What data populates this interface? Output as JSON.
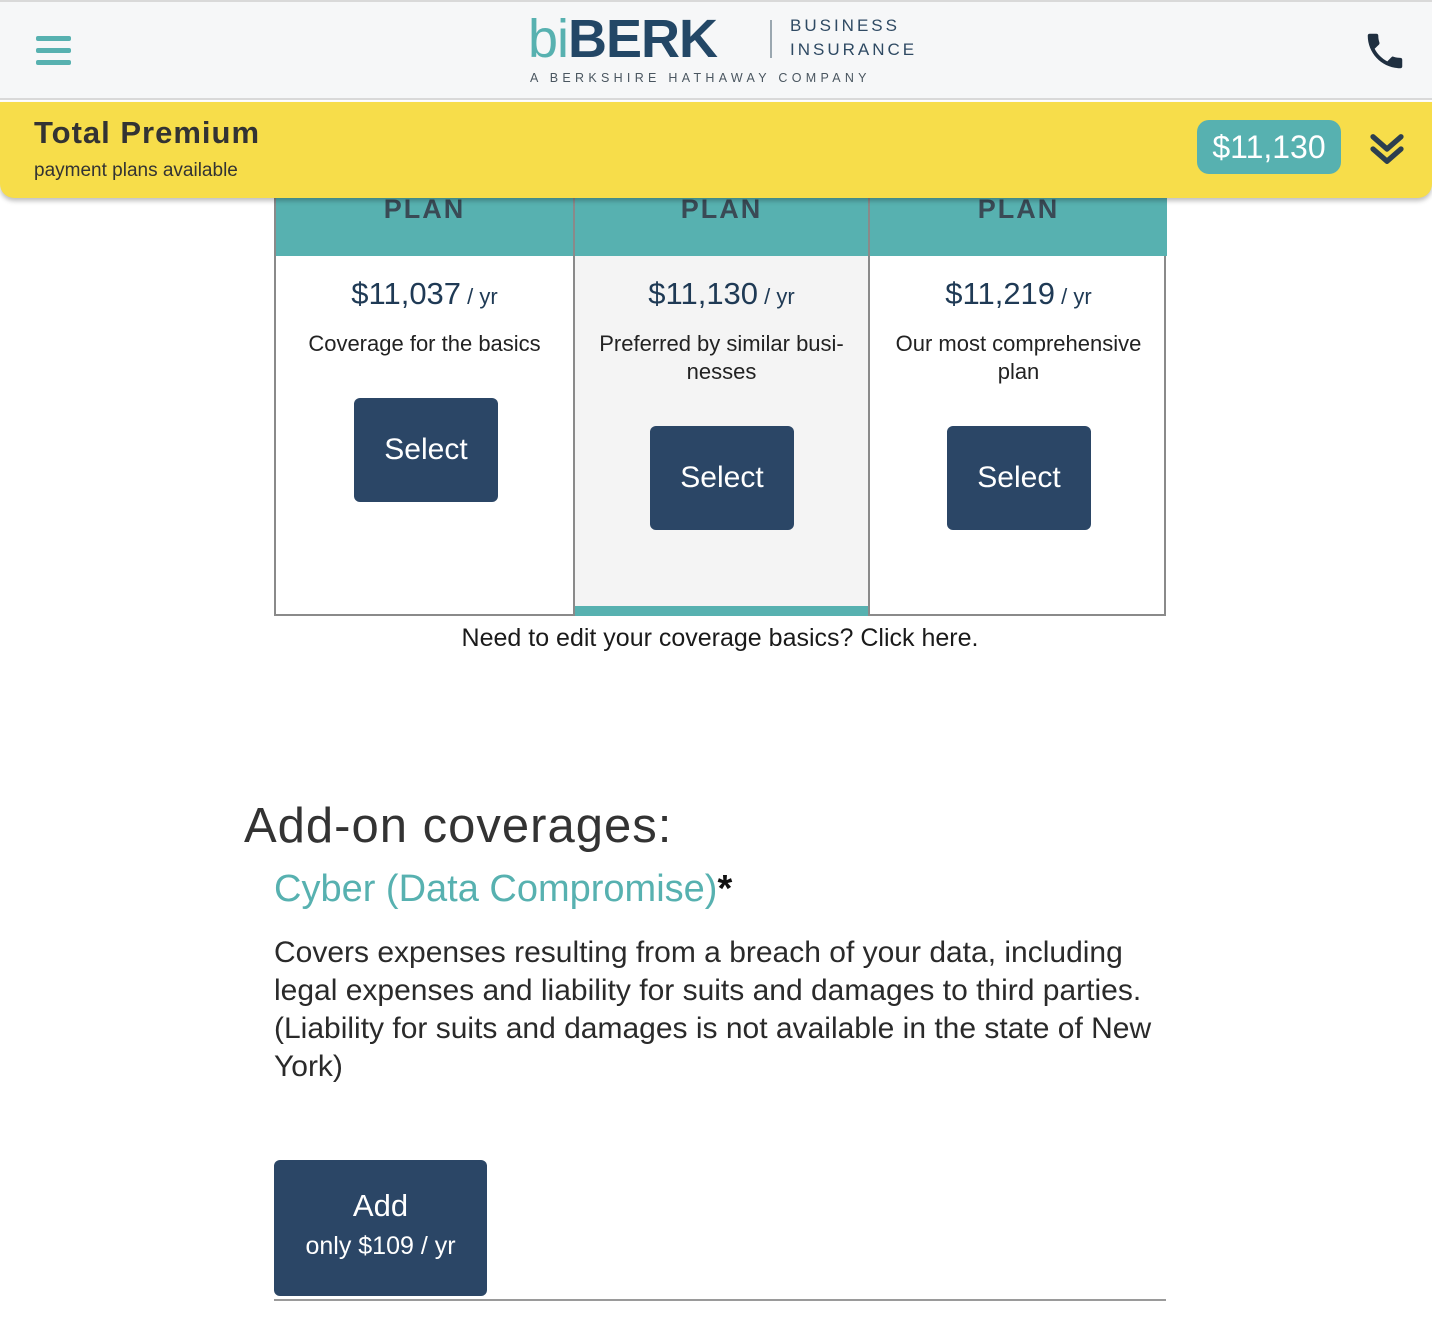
{
  "header": {
    "logo_bi": "bi",
    "logo_berk": "BERK",
    "logo_business_line1": "BUSINESS",
    "logo_business_line2": "INSURANCE",
    "logo_tagline": "A BERKSHIRE HATHAWAY COMPANY",
    "menu_icon": "hamburger-menu-icon",
    "phone_icon": "phone-icon"
  },
  "premium": {
    "title": "Total Premium",
    "subtitle": "payment plans available",
    "amount": "$11,130",
    "expand_icon": "double-chevron-down-icon"
  },
  "plans": [
    {
      "header": "PLAN",
      "price": "$11,037",
      "per": " / yr",
      "description": "Coverage for the basics",
      "button": "Select",
      "selected": false
    },
    {
      "header": "PLAN",
      "price": "$11,130",
      "per": " / yr",
      "description": "Preferred by similar busi- nesses",
      "button": "Select",
      "selected": true
    },
    {
      "header": "PLAN",
      "price": "$11,219",
      "per": " / yr",
      "description": "Our most comprehensive plan",
      "button": "Select",
      "selected": false
    }
  ],
  "edit_link": "Need to edit your coverage basics? Click here.",
  "addons": {
    "title": "Add-on coverages:",
    "cyber": {
      "title": "Cyber (Data Compromise)",
      "asterisk": "*",
      "description": "Covers expenses resulting from a breach of your data, including legal expenses and liability for suits and damages to third parties. (Liability for suits and damages is not available in the state of New York)",
      "button_line1": "Add",
      "button_line2": "only $109 / yr"
    }
  },
  "colors": {
    "accent_teal": "#57b1b0",
    "navy": "#2b4666",
    "premium_yellow": "#f7dd4a"
  }
}
